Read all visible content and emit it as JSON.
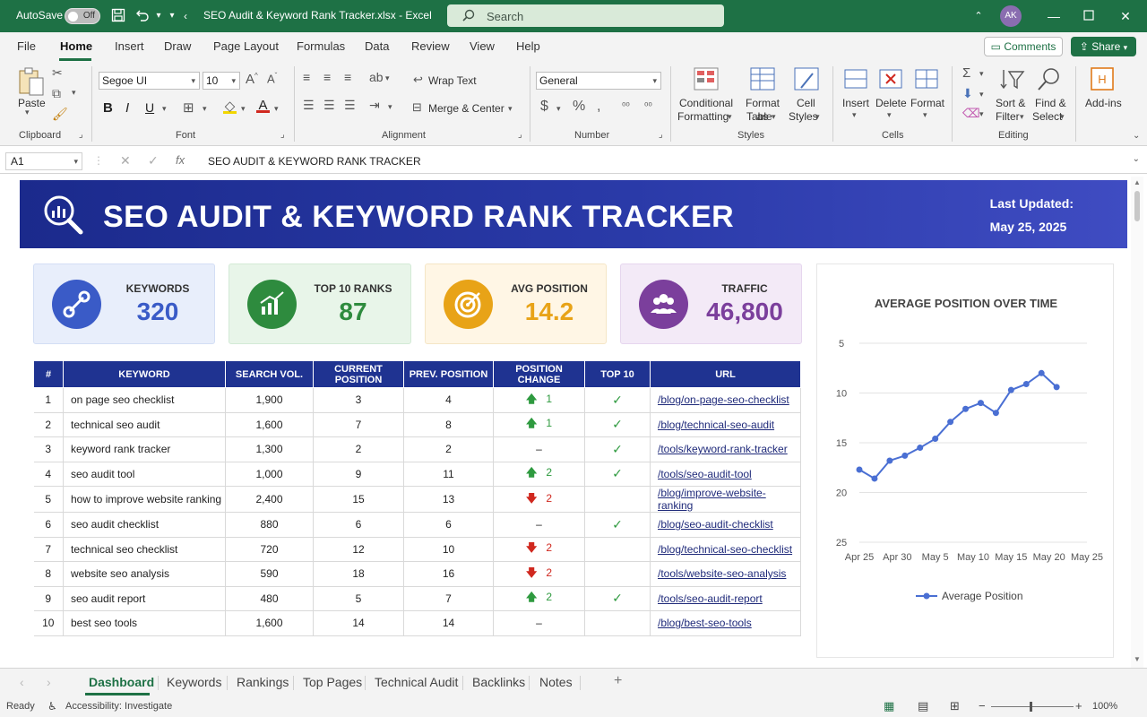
{
  "titlebar": {
    "autosave_label": "AutoSave",
    "autosave_state": "Off",
    "doc_title": "SEO Audit & Keyword Rank Tracker.xlsx - Excel",
    "search_placeholder": "Search",
    "user_initials": "AK",
    "colors": {
      "bg": "#1e7145"
    }
  },
  "menu": {
    "items": [
      "File",
      "Home",
      "Insert",
      "Draw",
      "Page Layout",
      "Formulas",
      "Data",
      "Review",
      "View",
      "Help"
    ],
    "active": "Home",
    "comments_label": "Comments",
    "share_label": "Share"
  },
  "ribbon": {
    "paste_label": "Paste",
    "clipboard_label": "Clipboard",
    "font_name": "Segoe UI",
    "font_size": "10",
    "font_label": "Font",
    "wrap_text_label": "Wrap Text",
    "merge_center_label": "Merge & Center",
    "alignment_label": "Alignment",
    "number_format": "General",
    "number_label": "Number",
    "conditional_formatting_l1": "Conditional",
    "conditional_formatting_l2": "Formatting",
    "format_as_table_l1": "Format as",
    "format_as_table_l2": "Table",
    "cell_styles_l1": "Cell",
    "cell_styles_l2": "Styles",
    "styles_label": "Styles",
    "insert_label": "Insert",
    "delete_label": "Delete",
    "format_label": "Format",
    "cells_label": "Cells",
    "sort_filter_l1": "Sort &",
    "sort_filter_l2": "Filter",
    "find_select_l1": "Find &",
    "find_select_l2": "Select",
    "editing_label": "Editing",
    "addins_label": "Add-ins"
  },
  "formula_bar": {
    "cell_ref": "A1",
    "content": "SEO AUDIT & KEYWORD RANK TRACKER"
  },
  "dashboard": {
    "title": "SEO AUDIT & KEYWORD RANK TRACKER",
    "last_updated_label": "Last Updated:",
    "last_updated_value": "May 25, 2025",
    "kpis": [
      {
        "label": "KEYWORDS",
        "value": "320",
        "color": "#3a5bc7",
        "bg": "#e8eefb",
        "icon": "link-icon"
      },
      {
        "label": "TOP 10 RANKS",
        "value": "87",
        "color": "#2e8b3e",
        "bg": "#e8f5e9",
        "icon": "bar-chart-icon"
      },
      {
        "label": "AVG POSITION",
        "value": "14.2",
        "color": "#e8a317",
        "bg": "#fff6e5",
        "icon": "target-icon"
      },
      {
        "label": "TRAFFIC",
        "value": "46,800",
        "color": "#7b3f9c",
        "bg": "#f3eaf7",
        "icon": "users-icon"
      }
    ],
    "table": {
      "headers": [
        "#",
        "KEYWORD",
        "SEARCH VOL.",
        "CURRENT POSITION",
        "PREV. POSITION",
        "POSITION CHANGE",
        "TOP 10",
        "URL"
      ],
      "rows": [
        {
          "n": "1",
          "keyword": "on page seo checklist",
          "vol": "1,900",
          "cur": "3",
          "prev": "4",
          "dir": "up",
          "chg": "1",
          "top10": true,
          "url": "/blog/on-page-seo-checklist"
        },
        {
          "n": "2",
          "keyword": "technical seo audit",
          "vol": "1,600",
          "cur": "7",
          "prev": "8",
          "dir": "up",
          "chg": "1",
          "top10": true,
          "url": "/blog/technical-seo-audit"
        },
        {
          "n": "3",
          "keyword": "keyword rank tracker",
          "vol": "1,300",
          "cur": "2",
          "prev": "2",
          "dir": "none",
          "chg": "–",
          "top10": true,
          "url": "/tools/keyword-rank-tracker"
        },
        {
          "n": "4",
          "keyword": "seo audit tool",
          "vol": "1,000",
          "cur": "9",
          "prev": "11",
          "dir": "up",
          "chg": "2",
          "top10": true,
          "url": "/tools/seo-audit-tool"
        },
        {
          "n": "5",
          "keyword": "how to improve website ranking",
          "vol": "2,400",
          "cur": "15",
          "prev": "13",
          "dir": "down",
          "chg": "2",
          "top10": false,
          "url": "/blog/improve-website-ranking"
        },
        {
          "n": "6",
          "keyword": "seo audit checklist",
          "vol": "880",
          "cur": "6",
          "prev": "6",
          "dir": "none",
          "chg": "–",
          "top10": true,
          "url": "/blog/seo-audit-checklist"
        },
        {
          "n": "7",
          "keyword": "technical seo checklist",
          "vol": "720",
          "cur": "12",
          "prev": "10",
          "dir": "down",
          "chg": "2",
          "top10": false,
          "url": "/blog/technical-seo-checklist"
        },
        {
          "n": "8",
          "keyword": "website seo analysis",
          "vol": "590",
          "cur": "18",
          "prev": "16",
          "dir": "down",
          "chg": "2",
          "top10": false,
          "url": "/tools/website-seo-analysis"
        },
        {
          "n": "9",
          "keyword": "seo audit report",
          "vol": "480",
          "cur": "5",
          "prev": "7",
          "dir": "up",
          "chg": "2",
          "top10": true,
          "url": "/tools/seo-audit-report"
        },
        {
          "n": "10",
          "keyword": "best seo tools",
          "vol": "1,600",
          "cur": "14",
          "prev": "14",
          "dir": "none",
          "chg": "–",
          "top10": false,
          "url": "/blog/best-seo-tools"
        }
      ]
    }
  },
  "chart_data": {
    "type": "line",
    "title": "AVERAGE POSITION OVER TIME",
    "x_tick_labels": [
      "Apr 25",
      "Apr 30",
      "May 5",
      "May 10",
      "May 15",
      "May 20",
      "May 25"
    ],
    "x": [
      0,
      2,
      4,
      6,
      8,
      10,
      12,
      14,
      16,
      18,
      20,
      22,
      24,
      26,
      28,
      30
    ],
    "series": [
      {
        "name": "Average Position",
        "values": [
          17.7,
          18.6,
          16.8,
          16.3,
          15.5,
          14.6,
          12.9,
          11.6,
          11.0,
          12.0,
          9.7,
          9.1,
          8.0,
          9.4
        ]
      }
    ],
    "ylim": [
      5,
      25
    ],
    "y_reversed": true,
    "y_ticks": [
      5,
      10,
      15,
      20,
      25
    ],
    "grid": true,
    "legend_position": "bottom",
    "color": "#4a6fd3"
  },
  "sheet_tabs": {
    "tabs": [
      "Dashboard",
      "Keywords",
      "Rankings",
      "Top Pages",
      "Technical Audit",
      "Backlinks",
      "Notes"
    ],
    "active": "Dashboard"
  },
  "status": {
    "ready": "Ready",
    "accessibility": "Accessibility: Investigate",
    "zoom": "100%"
  }
}
